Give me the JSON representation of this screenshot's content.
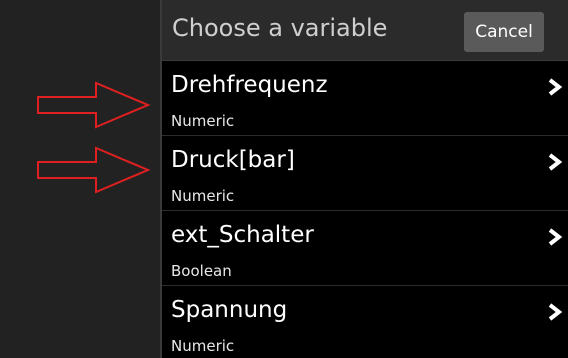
{
  "header": {
    "title": "Choose a variable",
    "cancel_label": "Cancel"
  },
  "variables": [
    {
      "name": "Drehfrequenz",
      "type": "Numeric",
      "chevron_icon": "chevron-right-icon"
    },
    {
      "name": "Druck[bar]",
      "type": "Numeric",
      "chevron_icon": "chevron-right-icon"
    },
    {
      "name": "ext_Schalter",
      "type": "Boolean",
      "chevron_icon": "chevron-right-icon"
    },
    {
      "name": "Spannung",
      "type": "Numeric",
      "chevron_icon": "chevron-right-icon"
    }
  ],
  "annotations": {
    "arrow_icon": "red-arrow-icon",
    "arrow_color": "#e02020",
    "arrow_count": 2
  },
  "colors": {
    "panel_bg": "#000000",
    "header_bg": "#2b2b2b",
    "button_bg": "#5a5a5a",
    "sidebar_bg": "#222222"
  }
}
